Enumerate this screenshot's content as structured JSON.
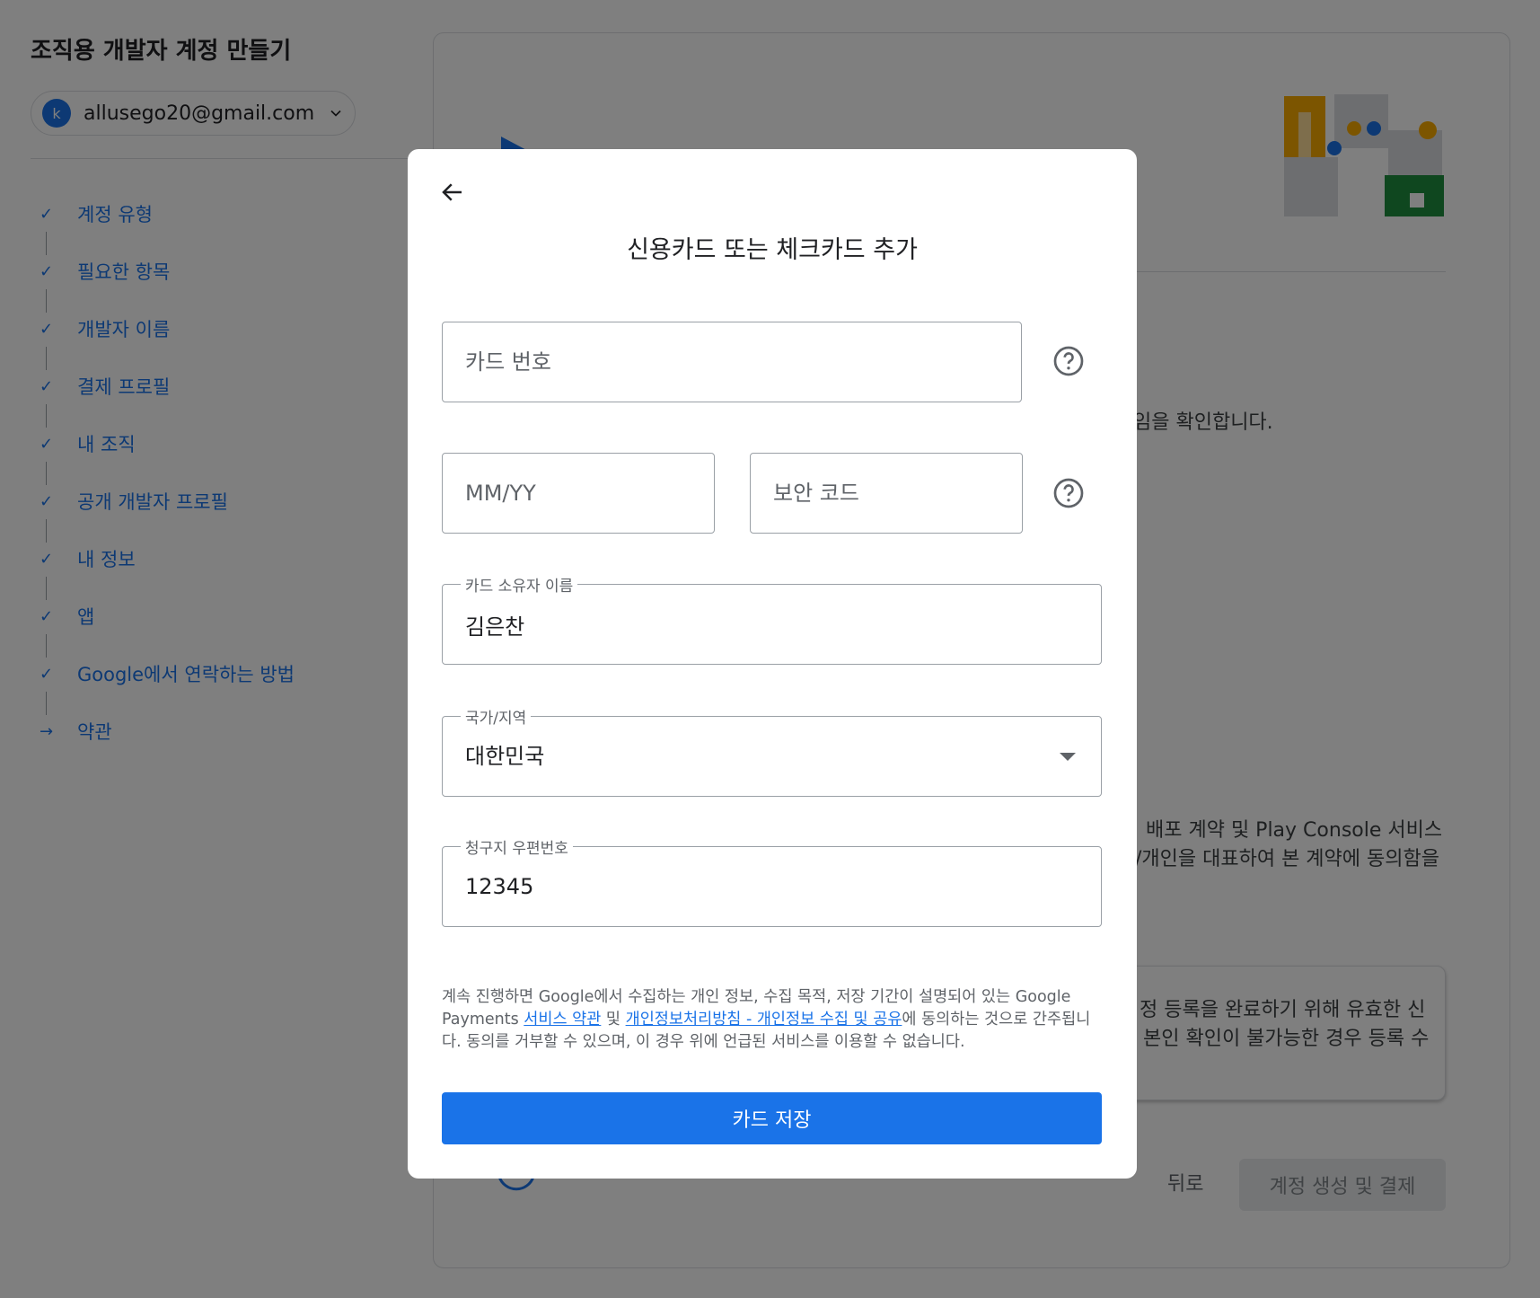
{
  "background": {
    "page_title": "조직용 개발자 계정 만들기",
    "account": {
      "avatar_letter": "k",
      "email": "allusego20@gmail.com"
    },
    "steps": [
      {
        "label": "계정 유형",
        "status": "done"
      },
      {
        "label": "필요한 항목",
        "status": "done"
      },
      {
        "label": "개발자 이름",
        "status": "done"
      },
      {
        "label": "결제 프로필",
        "status": "done"
      },
      {
        "label": "내 조직",
        "status": "done"
      },
      {
        "label": "공개 개발자 프로필",
        "status": "done"
      },
      {
        "label": "내 정보",
        "status": "done"
      },
      {
        "label": "앱",
        "status": "done"
      },
      {
        "label": "Google에서 연락하는 방법",
        "status": "done"
      },
      {
        "label": "약관",
        "status": "current"
      }
    ],
    "partial_texts": {
      "confirm": "임을 확인합니다.",
      "agreement_line1": "배포 계약 및 Play Console 서비스",
      "agreement_line2": "/개인을 대표하여 본 계약에 동의함을",
      "notice_line1": "정 등록을 완료하기 위해 유효한 신",
      "notice_line2": "본인 확인이 불가능한 경우 등록 수"
    },
    "back_label": "뒤로",
    "create_label": "계정 생성 및 결제"
  },
  "dialog": {
    "title": "신용카드 또는 체크카드 추가",
    "card_number_placeholder": "카드 번호",
    "expiry_placeholder": "MM/YY",
    "cvc_placeholder": "보안 코드",
    "holder_label": "카드 소유자 이름",
    "holder_value": "김은찬",
    "country_label": "국가/지역",
    "country_value": "대한민국",
    "zip_label": "청구지 우편번호",
    "zip_value": "12345",
    "disclaimer": {
      "part1": "계속 진행하면 Google에서 수집하는 개인 정보, 수집 목적, 저장 기간이 설명되어 있는 Google Payments ",
      "link1": "서비스 약관",
      "part2": " 및 ",
      "link2": "개인정보처리방침 - 개인정보 수집 및 공유",
      "part3": "에 동의하는 것으로 간주됩니다. 동의를 거부할 수 있으며, 이 경우 위에 언급된 서비스를 이용할 수 없습니다."
    },
    "save_label": "카드 저장"
  },
  "colors": {
    "accent": "#1a73e8",
    "scrim": "rgba(0,0,0,0.5)"
  },
  "icons": {
    "back": "arrow-left-icon",
    "help": "help-circle-icon",
    "caret": "dropdown-arrow-icon",
    "check": "check-icon",
    "current_step": "arrow-right-icon"
  }
}
